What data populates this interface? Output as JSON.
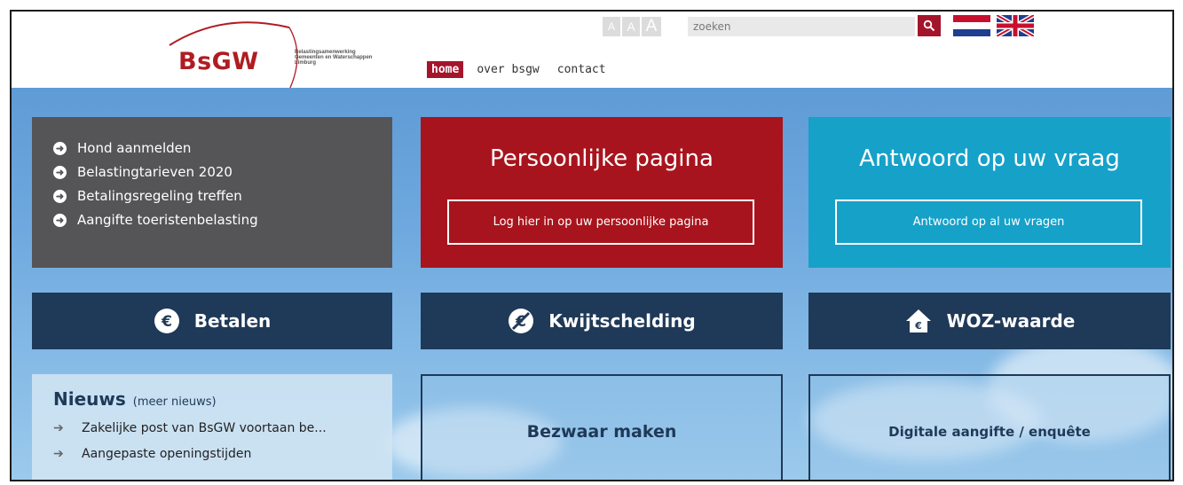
{
  "header": {
    "logo_text": "BsGW",
    "logo_sub_line1": "Belastingsamenwerking",
    "logo_sub_line2": "Gemeenten en Waterschappen",
    "logo_sub_line3": "Limburg",
    "font_size_labels": [
      "A",
      "A",
      "A"
    ],
    "search_placeholder": "zoeken",
    "nav": [
      "home",
      "over bsgw",
      "contact"
    ],
    "nav_active": "home"
  },
  "quick_links": [
    "Hond aanmelden",
    "Belastingtarieven 2020",
    "Betalingsregeling treffen",
    "Aangifte toeristenbelasting"
  ],
  "personal": {
    "title": "Persoonlijke pagina",
    "button": "Log hier in op uw persoonlijke pagina"
  },
  "answer": {
    "title": "Antwoord op uw vraag",
    "button": "Antwoord op al uw vragen"
  },
  "actions": {
    "pay": "Betalen",
    "kwijtschelding": "Kwijtschelding",
    "woz": "WOZ-waarde"
  },
  "news": {
    "title": "Nieuws",
    "more": "(meer nieuws)",
    "items": [
      "Zakelijke post van BsGW voortaan be...",
      "Aangepaste openingstijden"
    ]
  },
  "bezwaar": "Bezwaar maken",
  "digitaal": "Digitale aangifte / enquête",
  "colors": {
    "brand_red": "#a8141d",
    "teal": "#16a1c9",
    "navy": "#1f3958",
    "gray_tile": "#555557"
  }
}
